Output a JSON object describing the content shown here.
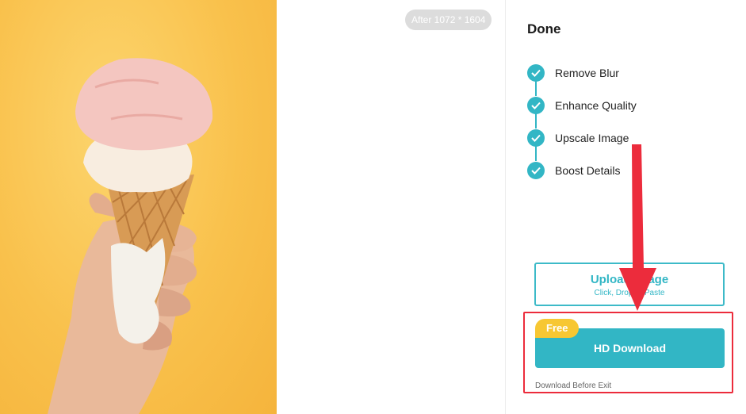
{
  "preview": {
    "size_badge": "After 1072 * 1604"
  },
  "panel": {
    "title": "Done",
    "steps": [
      {
        "label": "Remove Blur"
      },
      {
        "label": "Enhance Quality"
      },
      {
        "label": "Upscale Image"
      },
      {
        "label": "Boost Details"
      }
    ],
    "upload": {
      "title": "Upload Image",
      "subtitle": "Click, Drop or Paste"
    },
    "download": {
      "badge": "Free",
      "label": "HD Download",
      "note": "Download Before Exit"
    }
  },
  "colors": {
    "accent": "#32b6c5",
    "highlight": "#ec2c3c",
    "badge": "#f7c733",
    "photo_bg": "#f9c14c"
  },
  "icons": {
    "step": "check-icon",
    "annotation": "arrow-down-icon"
  }
}
